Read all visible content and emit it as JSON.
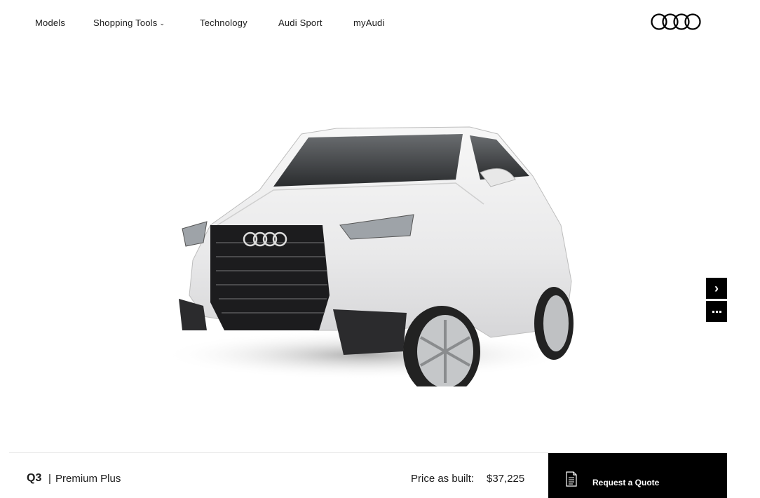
{
  "nav": {
    "items": [
      {
        "label": "Models"
      },
      {
        "label": "Shopping Tools",
        "has_dropdown": true
      },
      {
        "label": "Technology"
      },
      {
        "label": "Audi Sport"
      },
      {
        "label": "myAudi"
      }
    ],
    "logo_icon": "audi-four-rings-icon"
  },
  "viewer": {
    "image": "white-audi-q3-suv-front-three-quarter",
    "next_icon": "chevron-right-icon",
    "more_icon": "more-dots-icon"
  },
  "summary": {
    "model": "Q3",
    "separator": "|",
    "trim": "Premium Plus",
    "price_label": "Price as built:",
    "price_value": "$37,225",
    "quote_label": "Request a Quote",
    "quote_icon": "document-icon"
  },
  "colors": {
    "background": "#ffffff",
    "text": "#1a1a1a",
    "button_bg": "#000000",
    "button_text": "#ffffff"
  }
}
